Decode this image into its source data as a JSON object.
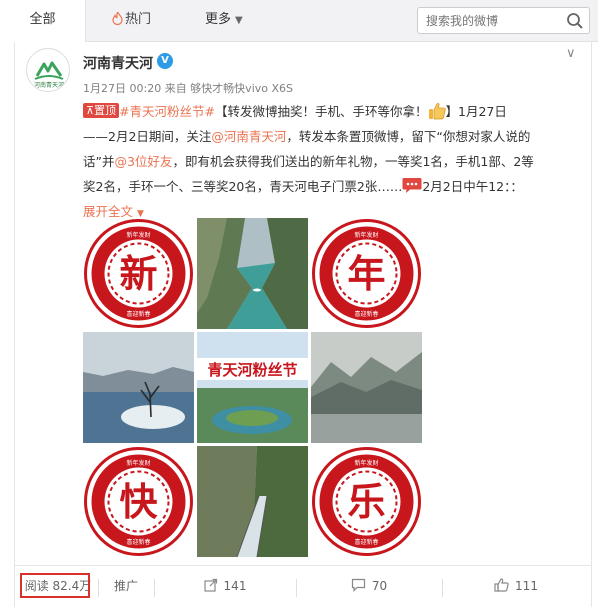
{
  "tabs": [
    {
      "label": "全部",
      "active": true
    },
    {
      "label": "热门",
      "icon": "flame-icon"
    },
    {
      "label": "更多",
      "icon": "chevron-down-icon"
    }
  ],
  "search": {
    "placeholder": "搜索我的微博"
  },
  "post": {
    "author": "河南青天河",
    "verified": true,
    "avatar_text": "河南青天河",
    "meta": "1月27日 00:20 来自 够快才畅快vivo X6S",
    "pin_label": "置顶",
    "topic": "#青天河粉丝节#",
    "lines": {
      "l1_text": "【转发微博抽奖！手机、手环等你拿！",
      "l1_end": "】1月27日",
      "l2_pre": "——2月2日期间，关注",
      "l2_mention": "@河南青天河",
      "l2_post": "，转发本条置顶微博，留下“你想对家人说的",
      "l3_pre": "话”并",
      "l3_mention": "@3位好友",
      "l3_post": "，即有机会获得我们送出的新年礼物，一等奖1名，手机1部、2等",
      "l4_text": "奖2名，手环一个、三等奖20名，青天河电子门票2张……",
      "l4_end": "2月2日中午12：："
    },
    "expand": "展开全文",
    "images": [
      {
        "kind": "papercut",
        "char": "新",
        "top_text": "新年发财",
        "bottom_text": "喜迎新春"
      },
      {
        "kind": "canyon-river"
      },
      {
        "kind": "papercut",
        "char": "年",
        "top_text": "新年发财",
        "bottom_text": "喜迎新春"
      },
      {
        "kind": "winter-tree"
      },
      {
        "kind": "banner-island",
        "banner_text": "青天河粉丝节"
      },
      {
        "kind": "misty-river"
      },
      {
        "kind": "papercut",
        "char": "快",
        "top_text": "新年发财",
        "bottom_text": "喜迎新春"
      },
      {
        "kind": "cliff-walkway"
      },
      {
        "kind": "papercut",
        "char": "乐",
        "top_text": "新年发财",
        "bottom_text": "喜迎新春"
      }
    ]
  },
  "footer": {
    "reads": "阅读 82.4万",
    "promote": "推广",
    "reposts": "141",
    "comments": "70",
    "likes": "111"
  },
  "colors": {
    "link": "#eb7350",
    "pin": "#e0473f",
    "papercut_red": "#c8161d",
    "verified_blue": "#2e9be6",
    "highlight_box": "#d9302a"
  }
}
